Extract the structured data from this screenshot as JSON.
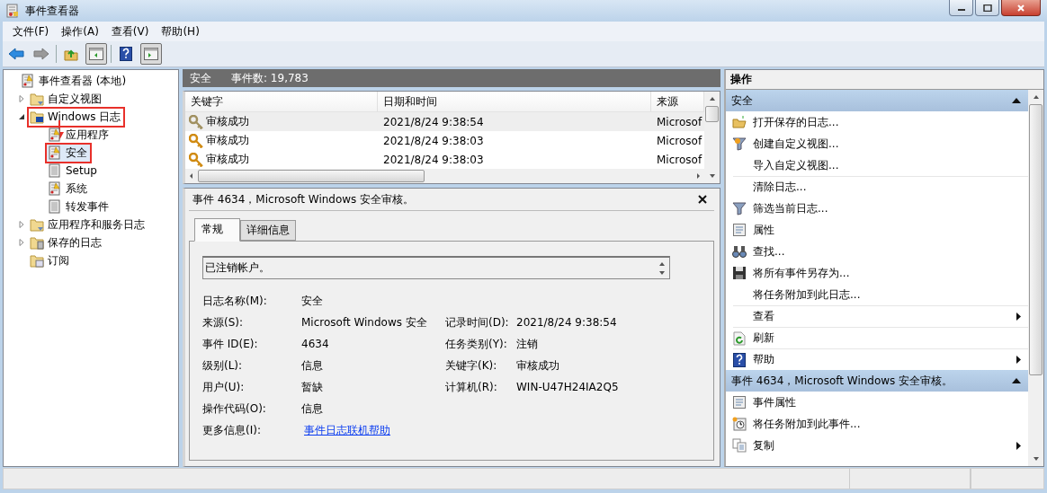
{
  "window": {
    "title": "事件查看器"
  },
  "menu": [
    "文件(F)",
    "操作(A)",
    "查看(V)",
    "帮助(H)"
  ],
  "toolbar": [
    {
      "kind": "back",
      "disabled": false,
      "pressed": false
    },
    {
      "kind": "forward",
      "disabled": true,
      "pressed": false
    },
    {
      "kind": "up",
      "pressed": false
    },
    {
      "kind": "tree-pane",
      "pressed": true
    },
    {
      "kind": "help",
      "pressed": false
    },
    {
      "kind": "action-pane",
      "pressed": true
    }
  ],
  "tree": [
    {
      "label": "事件查看器 (本地)",
      "kind": "root",
      "selected": false,
      "highlighted": false,
      "children": [
        {
          "label": "自定义视图",
          "kind": "folder",
          "expanded": false,
          "selected": false,
          "highlighted": false
        },
        {
          "label": "Windows 日志",
          "kind": "windows-folder",
          "expanded": true,
          "selected": false,
          "highlighted": true,
          "children": [
            {
              "label": "应用程序",
              "kind": "log",
              "selected": false,
              "highlighted": false
            },
            {
              "label": "安全",
              "kind": "log",
              "selected": true,
              "highlighted": true
            },
            {
              "label": "Setup",
              "kind": "plain-log",
              "selected": false,
              "highlighted": false
            },
            {
              "label": "系统",
              "kind": "log",
              "selected": false,
              "highlighted": false
            },
            {
              "label": "转发事件",
              "kind": "plain-log",
              "selected": false,
              "highlighted": false
            }
          ]
        },
        {
          "label": "应用程序和服务日志",
          "kind": "folder",
          "expanded": false,
          "selected": false,
          "highlighted": false
        },
        {
          "label": "保存的日志",
          "kind": "saved-folder",
          "expanded": false,
          "selected": false,
          "highlighted": false
        },
        {
          "label": "订阅",
          "kind": "subscription-folder",
          "selected": false,
          "highlighted": false
        }
      ]
    }
  ],
  "log_header": {
    "name": "安全",
    "count": "事件数: 19,783"
  },
  "events": {
    "columns": [
      "关键字",
      "日期和时间",
      "来源"
    ],
    "rows": [
      {
        "selected": true,
        "cells": [
          "审核成功",
          "2021/8/24 9:38:54",
          "Microsof"
        ]
      },
      {
        "selected": false,
        "cells": [
          "审核成功",
          "2021/8/24 9:38:03",
          "Microsof"
        ]
      },
      {
        "selected": false,
        "cells": [
          "审核成功",
          "2021/8/24 9:38:03",
          "Microsof"
        ]
      }
    ]
  },
  "detail": {
    "title": "事件 4634，Microsoft Windows 安全审核。",
    "tabs": [
      {
        "label": "常规",
        "selected": true
      },
      {
        "label": "详细信息",
        "selected": false
      }
    ],
    "description": "已注销帐户。",
    "rows": [
      {
        "left": {
          "label": "日志名称(M):",
          "value": "安全"
        }
      },
      {
        "left": {
          "label": "来源(S):",
          "value": "Microsoft Windows 安全"
        },
        "right": {
          "label": "记录时间(D):",
          "value": "2021/8/24 9:38:54"
        }
      },
      {
        "left": {
          "label": "事件 ID(E):",
          "value": "4634"
        },
        "right": {
          "label": "任务类别(Y):",
          "value": "注销"
        }
      },
      {
        "left": {
          "label": "级别(L):",
          "value": "信息"
        },
        "right": {
          "label": "关键字(K):",
          "value": "审核成功"
        }
      },
      {
        "left": {
          "label": "用户(U):",
          "value": "暂缺"
        },
        "right": {
          "label": "计算机(R):",
          "value": "WIN-U47H24IA2Q5"
        }
      },
      {
        "left": {
          "label": "操作代码(O):",
          "value": "信息"
        }
      },
      {
        "left": {
          "label": "更多信息(I):",
          "value": "事件日志联机帮助",
          "kind": "link"
        }
      }
    ]
  },
  "actions": {
    "title": "操作",
    "sections": [
      {
        "title": "安全",
        "expanded": true,
        "items": [
          {
            "label": "打开保存的日志...",
            "kind": "open",
            "divider": false,
            "submenu": false
          },
          {
            "label": "创建自定义视图...",
            "kind": "create-view",
            "divider": false,
            "submenu": false
          },
          {
            "label": "导入自定义视图...",
            "kind": "plain",
            "divider": false,
            "submenu": false
          },
          {
            "label": "清除日志...",
            "kind": "plain",
            "divider": true,
            "submenu": false
          },
          {
            "label": "筛选当前日志...",
            "kind": "filter",
            "divider": false,
            "submenu": false
          },
          {
            "label": "属性",
            "kind": "properties",
            "divider": false,
            "submenu": false
          },
          {
            "label": "查找...",
            "kind": "find",
            "divider": false,
            "submenu": false
          },
          {
            "label": "将所有事件另存为...",
            "kind": "save",
            "divider": false,
            "submenu": false
          },
          {
            "label": "将任务附加到此日志...",
            "kind": "plain",
            "divider": false,
            "submenu": false
          },
          {
            "label": "查看",
            "kind": "plain",
            "divider": true,
            "submenu": true
          },
          {
            "label": "刷新",
            "kind": "refresh",
            "divider": true,
            "submenu": false
          },
          {
            "label": "帮助",
            "kind": "help",
            "divider": true,
            "submenu": true
          }
        ]
      },
      {
        "title": "事件 4634，Microsoft Windows 安全审核。",
        "expanded": true,
        "items": [
          {
            "label": "事件属性",
            "kind": "properties",
            "divider": false,
            "submenu": false
          },
          {
            "label": "将任务附加到此事件...",
            "kind": "task",
            "divider": false,
            "submenu": false
          },
          {
            "label": "复制",
            "kind": "copy",
            "divider": false,
            "submenu": true
          }
        ]
      }
    ]
  }
}
